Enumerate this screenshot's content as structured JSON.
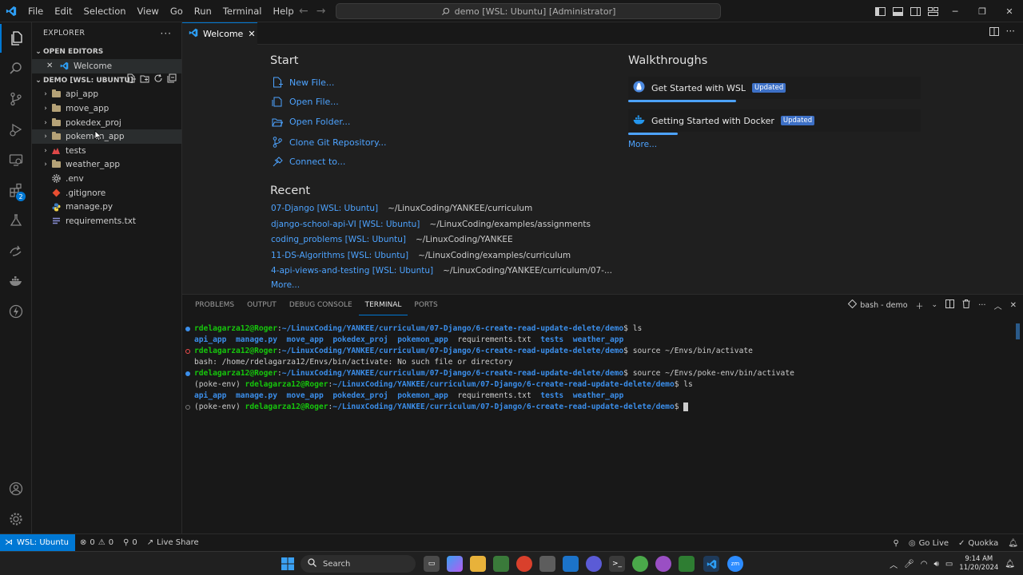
{
  "menu": [
    "File",
    "Edit",
    "Selection",
    "View",
    "Go",
    "Run",
    "Terminal",
    "Help"
  ],
  "command_center": "demo [WSL: Ubuntu] [Administrator]",
  "sidebar": {
    "title": "EXPLORER",
    "open_editors_label": "OPEN EDITORS",
    "open_editor_file": "Welcome",
    "workspace_label": "DEMO [WSL: UBUNTU]",
    "items": [
      {
        "label": "api_app",
        "type": "folder"
      },
      {
        "label": "move_app",
        "type": "folder"
      },
      {
        "label": "pokedex_proj",
        "type": "folder"
      },
      {
        "label": "pokemon_app",
        "type": "folder"
      },
      {
        "label": "tests",
        "type": "folder"
      },
      {
        "label": "weather_app",
        "type": "folder"
      },
      {
        "label": ".env",
        "type": "file"
      },
      {
        "label": ".gitignore",
        "type": "file"
      },
      {
        "label": "manage.py",
        "type": "file"
      },
      {
        "label": "requirements.txt",
        "type": "file"
      }
    ]
  },
  "tab": {
    "label": "Welcome"
  },
  "welcome": {
    "start_title": "Start",
    "start_items": [
      "New File...",
      "Open File...",
      "Open Folder...",
      "Clone Git Repository...",
      "Connect to..."
    ],
    "recent_title": "Recent",
    "recent": [
      {
        "name": "07-Django [WSL: Ubuntu]",
        "path": "~/LinuxCoding/YANKEE/curriculum"
      },
      {
        "name": "django-school-api-VI [WSL: Ubuntu]",
        "path": "~/LinuxCoding/examples/assignments"
      },
      {
        "name": "coding_problems [WSL: Ubuntu]",
        "path": "~/LinuxCoding/YANKEE"
      },
      {
        "name": "11-DS-Algorithms [WSL: Ubuntu]",
        "path": "~/LinuxCoding/examples/curriculum"
      },
      {
        "name": "4-api-views-and-testing [WSL: Ubuntu]",
        "path": "~/LinuxCoding/YANKEE/curriculum/07-..."
      }
    ],
    "recent_more": "More...",
    "walkthroughs_title": "Walkthroughs",
    "walkthroughs": [
      {
        "label": "Get Started with WSL",
        "badge": "Updated",
        "progress": 0.37
      },
      {
        "label": "Getting Started with Docker",
        "badge": "Updated",
        "progress": 0.17
      }
    ],
    "walk_more": "More..."
  },
  "panel": {
    "tabs": [
      "PROBLEMS",
      "OUTPUT",
      "DEBUG CONSOLE",
      "TERMINAL",
      "PORTS"
    ],
    "active_tab": "TERMINAL",
    "terminal_name": "bash - demo"
  },
  "terminal": {
    "prompt_user": "rdelagarza12@Roger",
    "cwd": "~/LinuxCoding/YANKEE/curriculum/07-Django/6-create-read-update-delete/demo",
    "cmd1": " ls",
    "ls_out": [
      "api_app",
      "manage.py",
      "move_app",
      "pokedex_proj",
      "pokemon_app",
      "requirements.txt",
      "tests",
      "weather_app"
    ],
    "cmd2": " source ~/Envs/bin/activate",
    "error": "bash: /home/rdelagarza12/Envs/bin/activate: No such file or directory",
    "cmd3": " source ~/Envs/poke-env/bin/activate",
    "env": "(poke-env) ",
    "cmd4": " ls"
  },
  "status": {
    "remote": "WSL: Ubuntu",
    "errors": "0",
    "warnings": "0",
    "ports": "0",
    "live_share": "Live Share",
    "go_live": "Go Live",
    "quokka": "Quokka"
  },
  "taskbar": {
    "search": "Search",
    "time": "9:14 AM",
    "date": "11/20/2024"
  },
  "colors": {
    "accent": "#0078d4",
    "link": "#4da3ff",
    "prompt_user": "#16c60c",
    "prompt_path": "#3b8eea"
  }
}
